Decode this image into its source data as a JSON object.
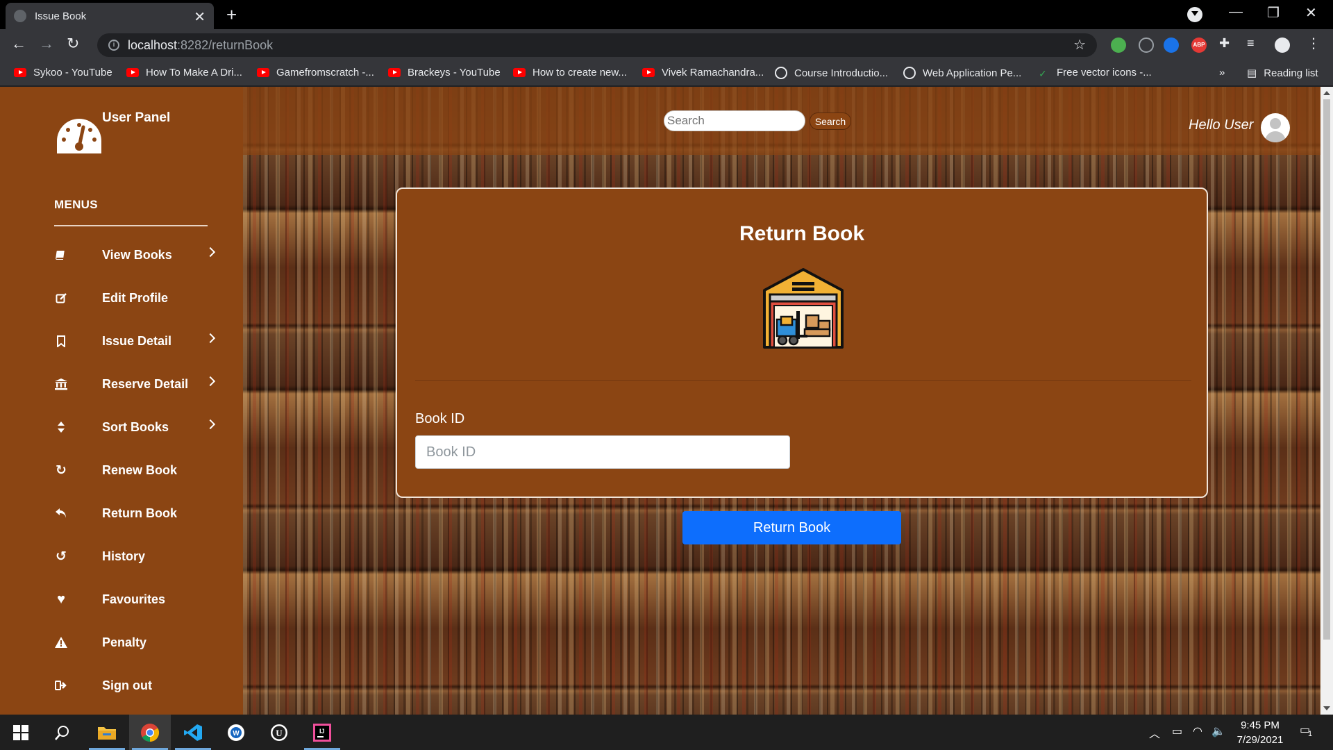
{
  "browser": {
    "tab_title": "Issue Book",
    "url_host": "localhost",
    "url_path": ":8282/returnBook",
    "reading_list": "Reading list",
    "bookmarks_overflow": "»",
    "bookmarks": [
      {
        "label": "Sykoo - YouTube",
        "icon": "youtube-icon"
      },
      {
        "label": "How To Make A Dri...",
        "icon": "youtube-icon"
      },
      {
        "label": "Gamefromscratch -...",
        "icon": "youtube-icon"
      },
      {
        "label": "Brackeys - YouTube",
        "icon": "youtube-icon"
      },
      {
        "label": "How to create new...",
        "icon": "youtube-icon"
      },
      {
        "label": "Vivek Ramachandra...",
        "icon": "youtube-icon"
      },
      {
        "label": "Course Introductio...",
        "icon": "globe-icon"
      },
      {
        "label": "Web Application Pe...",
        "icon": "globe-icon"
      },
      {
        "label": "Free vector icons -...",
        "icon": "leaf-icon"
      }
    ]
  },
  "sidebar": {
    "title": "User Panel",
    "menus_heading": "MENUS",
    "items": [
      {
        "label": "View Books",
        "icon": "book-icon",
        "has_submenu": true
      },
      {
        "label": "Edit Profile",
        "icon": "edit-icon",
        "has_submenu": false
      },
      {
        "label": "Issue Detail",
        "icon": "bookmark-icon",
        "has_submenu": true
      },
      {
        "label": "Reserve Detail",
        "icon": "bank-icon",
        "has_submenu": true
      },
      {
        "label": "Sort Books",
        "icon": "sort-icon",
        "has_submenu": true
      },
      {
        "label": "Renew Book",
        "icon": "refresh-icon",
        "has_submenu": false
      },
      {
        "label": "Return Book",
        "icon": "reply-icon",
        "has_submenu": false
      },
      {
        "label": "History",
        "icon": "history-icon",
        "has_submenu": false
      },
      {
        "label": "Favourites",
        "icon": "heart-icon",
        "has_submenu": false
      },
      {
        "label": "Penalty",
        "icon": "warning-icon",
        "has_submenu": false
      },
      {
        "label": "Sign out",
        "icon": "sign-out-icon",
        "has_submenu": false
      }
    ]
  },
  "topnav": {
    "search_placeholder": "Search",
    "search_button": "Search",
    "greeting": "Hello User"
  },
  "form": {
    "title": "Return Book",
    "book_id_label": "Book ID",
    "book_id_placeholder": "Book ID",
    "book_id_value": "",
    "submit_label": "Return Book"
  },
  "taskbar": {
    "time": "9:45 PM",
    "date": "7/29/2021",
    "notification_count": "1"
  },
  "colors": {
    "sidebar_bg": "#8b4513",
    "card_bg": "#8b4513",
    "primary_button": "#0d6efd"
  }
}
